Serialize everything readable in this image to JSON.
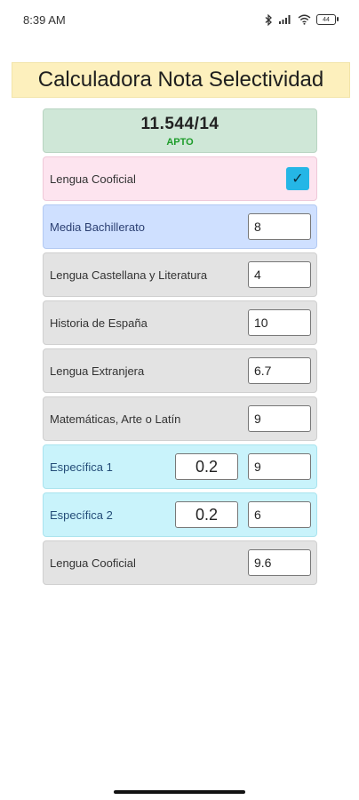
{
  "status_bar": {
    "time": "8:39 AM",
    "battery": "44"
  },
  "app": {
    "title": "Calculadora Nota Selectividad"
  },
  "result": {
    "score": "11.544/14",
    "status": "APTO"
  },
  "rows": {
    "lengua_cooficial_toggle": {
      "label": "Lengua Cooficial",
      "checked": true,
      "check_glyph": "✓"
    },
    "media_bachillerato": {
      "label": "Media Bachillerato",
      "value": "8"
    },
    "lengua_castellana": {
      "label": "Lengua Castellana y Literatura",
      "value": "4"
    },
    "historia": {
      "label": "Historia de España",
      "value": "10"
    },
    "lengua_extranjera": {
      "label": "Lengua Extranjera",
      "value": "6.7"
    },
    "matematicas": {
      "label": "Matemáticas, Arte o Latín",
      "value": "9"
    },
    "especifica_1": {
      "label": "Específica 1",
      "weight": "0.2",
      "value": "9"
    },
    "especifica_2": {
      "label": "Específica 2",
      "weight": "0.2",
      "value": "6"
    },
    "lengua_cooficial_grade": {
      "label": "Lengua Cooficial",
      "value": "9.6"
    }
  },
  "colors": {
    "title_bg": "#fdf0bd",
    "result_bg": "#cfe7d7",
    "apto": "#1d9c2a",
    "pink": "#fde4ef",
    "blue": "#cfe0ff",
    "gray": "#e3e3e3",
    "cyan": "#c9f3fb",
    "checkbox": "#25b6e6"
  }
}
